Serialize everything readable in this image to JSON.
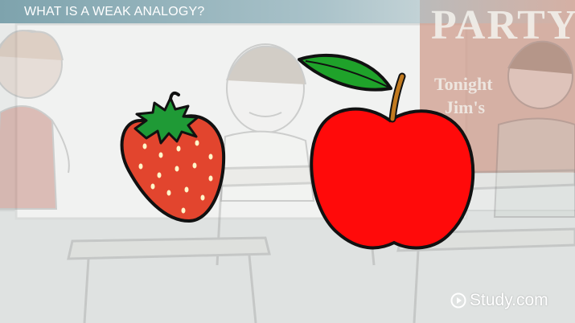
{
  "slide": {
    "title": "WHAT IS A WEAK ANALOGY?"
  },
  "poster": {
    "headline": "PARTY",
    "line1": "Tonight",
    "line2": "Jim's"
  },
  "watermark": {
    "brand": "Study.com",
    "icon": "play-circle-icon"
  },
  "illustrations": {
    "left": "strawberry",
    "right": "apple"
  },
  "colors": {
    "title_bar": "#7ea3ad",
    "background": "#e9ebea",
    "apple_red": "#ff0a0a",
    "strawberry_red": "#e2452e",
    "leaf_green": "#1fa22a",
    "stem_brown": "#c27a1f"
  }
}
